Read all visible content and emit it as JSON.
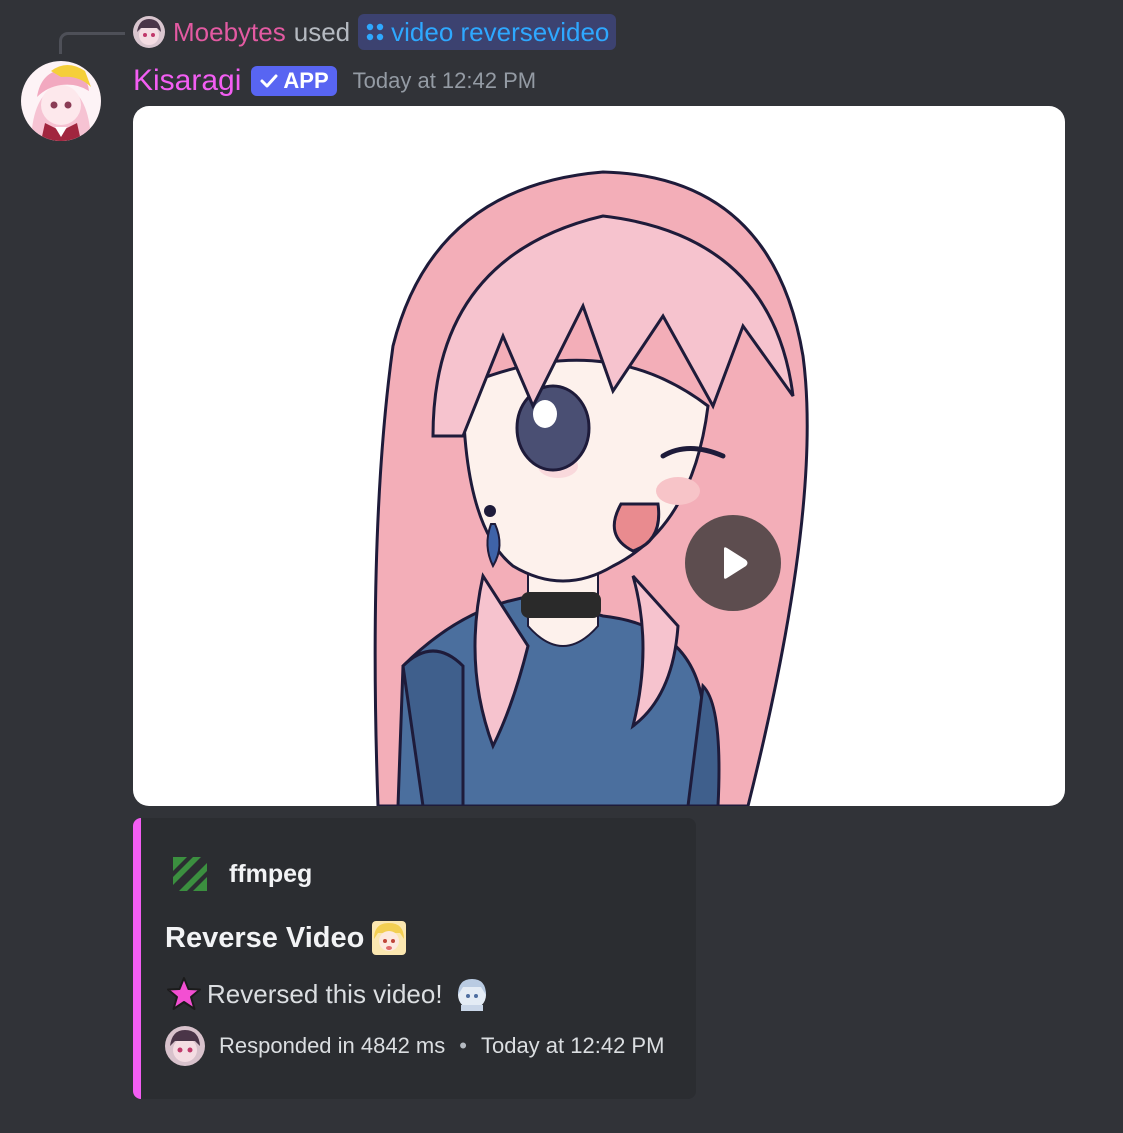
{
  "reply": {
    "user": "Moebytes",
    "used": "used",
    "command": "video reversevideo"
  },
  "message": {
    "author": "Kisaragi",
    "badge": "APP",
    "timestamp": "Today at 12:42 PM"
  },
  "video": {
    "state": "paused"
  },
  "embed": {
    "accent_color": "#f35ef3",
    "author_name": "ffmpeg",
    "title": "Reverse Video",
    "description": "Reversed this video!",
    "footer_response": "Responded in 4842 ms",
    "footer_separator": "•",
    "footer_time": "Today at 12:42 PM"
  },
  "colors": {
    "background": "#313338",
    "embed_background": "#2b2d31",
    "author_color": "#f35ef3",
    "reply_user_color": "#e35aa2",
    "command_color": "#2ea8ff",
    "badge_color": "#5865f2"
  },
  "icons": {
    "command": "app-command-icon",
    "badge": "checkmark-icon",
    "embed_author": "ffmpeg-logo-icon",
    "play": "play-icon",
    "title_emoji": "anime-girl-emoji",
    "desc_lead": "star-emoji",
    "desc_trail": "chibi-emoji"
  }
}
